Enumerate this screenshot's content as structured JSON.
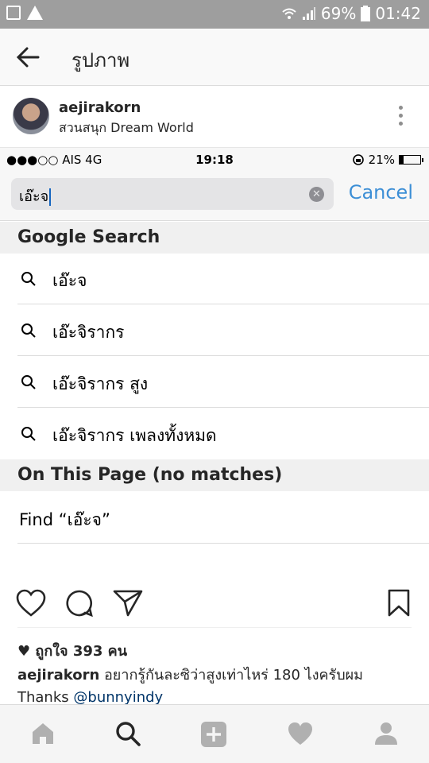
{
  "android_status": {
    "battery_percent": "69%",
    "time": "01:42",
    "icons": [
      "gallery-icon",
      "warning-icon",
      "wifi-icon",
      "signal-icon",
      "battery-icon"
    ]
  },
  "header": {
    "title": "รูปภาพ",
    "back_icon": "back-arrow-icon"
  },
  "post": {
    "username": "aejirakorn",
    "location": "สวนสนุก Dream World",
    "more_icon": "more-vertical-icon"
  },
  "screenshot": {
    "status": {
      "carrier": "●●●○○ AIS   4G",
      "time": "19:18",
      "battery": "21%",
      "battery_level": 0.21
    },
    "search": {
      "value": "เอ๊ะจ",
      "cancel_label": "Cancel"
    },
    "google_section_title": "Google Search",
    "suggestions": [
      "เอ๊ะจ",
      "เอ๊ะจิรากร",
      "เอ๊ะจิรากร สูง",
      "เอ๊ะจิรากร เพลงทั้งหมด"
    ],
    "on_page_title": "On This Page (no matches)",
    "find_label": "Find “เอ๊ะจ”"
  },
  "actions": {
    "icons": [
      "heart-icon",
      "comment-icon",
      "share-icon",
      "bookmark-icon"
    ]
  },
  "likes": "ถูกใจ 393 คน",
  "caption": {
    "username": "aejirakorn",
    "text": "อยากรู้กันละซิว่าสูงเท่าไหร่ 180 ไงครับผม",
    "thanks": "Thanks",
    "mention": "@bunnyindy"
  },
  "bottom_nav": {
    "tabs": [
      "home-icon",
      "search-icon",
      "add-icon",
      "activity-icon",
      "profile-icon"
    ],
    "active": "search-icon"
  },
  "colors": {
    "link_blue": "#3d8fd6",
    "status_gray": "#9e9e9e",
    "mention_blue": "#003569"
  }
}
